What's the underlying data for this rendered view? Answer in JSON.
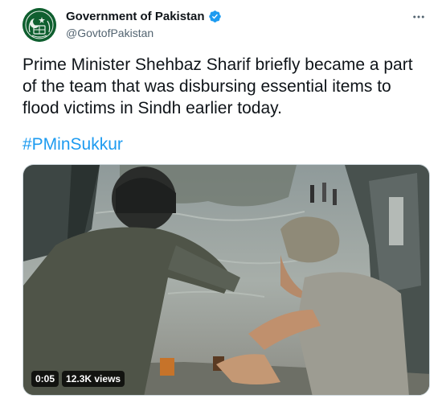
{
  "author": {
    "name": "Government of Pakistan",
    "handle": "@GovtofPakistan",
    "verified": true,
    "avatar_icon": "pakistan-state-emblem-icon"
  },
  "tweet": {
    "text": "Prime Minister Shehbaz Sharif briefly became a part of the team that was disbursing essential items to flood victims in Sindh earlier today.",
    "hashtag": "#PMinSukkur"
  },
  "media": {
    "type": "video",
    "timestamp": "0:05",
    "views": "12.3K views"
  },
  "icons": {
    "more": "more-options-icon",
    "verified": "verified-badge-icon"
  },
  "colors": {
    "link": "#1d9bf0",
    "verified": "#1d9bf0",
    "secondary_text": "#536471",
    "avatar_bg": "#0f5f2f"
  }
}
